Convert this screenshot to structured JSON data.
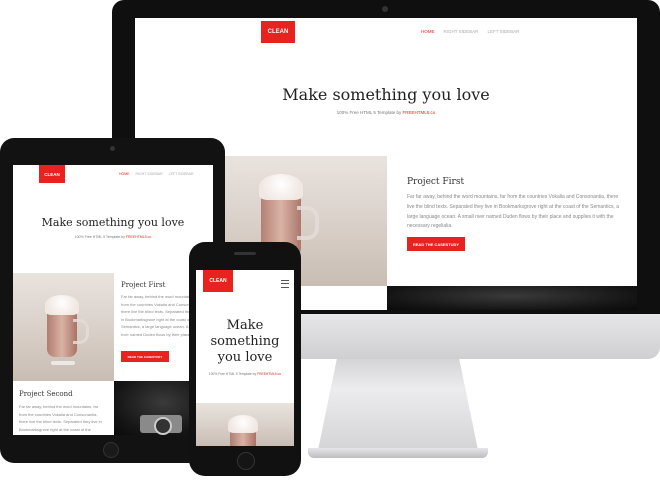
{
  "site": {
    "logo": "CLEAN",
    "nav": [
      "HOME",
      "RIGHT SIDEBAR",
      "LEFT SIDEBAR"
    ],
    "hero_title": "Make something you love",
    "tagline": "100% Free HTML 5 Template by",
    "tagline_link": "FREEHTML5.co",
    "project1_title": "Project First",
    "project1_body": "Far far away, behind the word mountains, far from the countries Vokalia and Consonantia, there live the blind texts. Separated they live in Bookmarksgrove right at the coast of the Semantics, a large language ocean. A small river named Duden flows by their place and supplies it with the necessary regelialia.",
    "button": "READ THE CASESTUDY",
    "project2_title": "Project Second",
    "project2_body": "Far far away, behind the word mountains, far from the countries Vokalia and Consonantia, there live the blind texts. Separated they live in Bookmarksgrove right at the coast of the Semantics."
  },
  "colors": {
    "accent": "#e8231f",
    "device": "#111111",
    "stand": "#d9d9db"
  },
  "icons": {
    "menu": "hamburger-icon",
    "camera": "camera-icon",
    "home": "home-button-icon"
  }
}
